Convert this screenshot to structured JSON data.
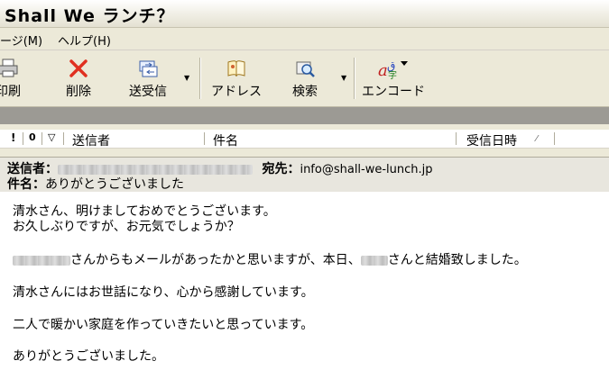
{
  "window": {
    "title": "Shall We ランチ？"
  },
  "menu": {
    "items": [
      {
        "label": "ージ(M)"
      },
      {
        "label": "ヘルプ(H)"
      }
    ]
  },
  "toolbar": {
    "print_label": "印刷",
    "delete_label": "削除",
    "sendrecv_label": "送受信",
    "address_label": "アドレス",
    "search_label": "検索",
    "encode_label": "エンコード"
  },
  "list_header": {
    "flag_col": "!",
    "attach_col": "0",
    "mark_col": "▽",
    "sender_col": "送信者",
    "subject_col": "件名",
    "received_col": "受信日時",
    "sort_indicator": "⁄"
  },
  "message": {
    "from_label": "送信者：",
    "to_label": "宛先：",
    "to_value": "info@shall-we-lunch.jp",
    "subject_label": "件名：",
    "subject_value": "ありがとうございました",
    "body": {
      "line1": "清水さん、明けましておめでとうございます。",
      "line2": "お久しぶりですが、お元気でしょうか？",
      "line3a": "さんからもメールがあったかと思いますが、本日、",
      "line3b": "さんと結婚致しました。",
      "line4": "清水さんにはお世話になり、心から感謝しています。",
      "line5": "二人で暖かい家庭を作っていきたいと思っています。",
      "line6": "ありがとうございました。"
    }
  },
  "colors": {
    "window_bg": "#ece9d8",
    "strip": "#9c9a94",
    "delete_x": "#e03020"
  }
}
